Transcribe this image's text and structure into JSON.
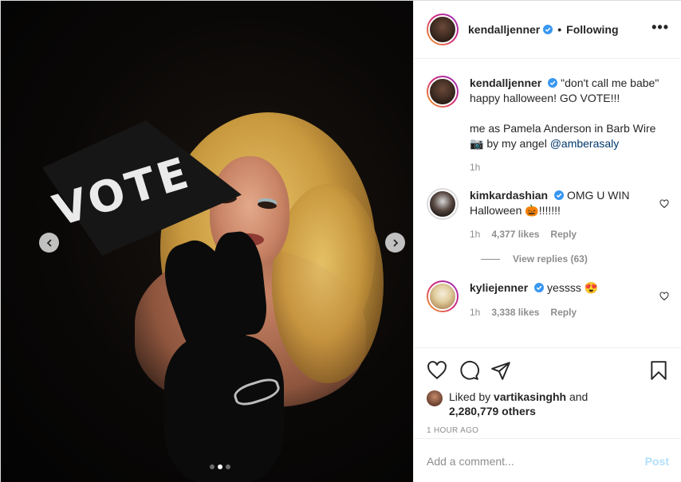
{
  "post": {
    "flag_text": "VOTE",
    "carousel": {
      "slides": 3,
      "active": 1
    }
  },
  "header": {
    "username": "kendalljenner",
    "separator": "•",
    "follow_status": "Following",
    "more": "•••"
  },
  "caption": {
    "username": "kendalljenner",
    "line1": "\"don't call me babe\" happy halloween! GO VOTE!!!",
    "line2_prefix": "me as Pamela Anderson in Barb Wire",
    "camera_emoji": "📷",
    "line2_mid": "by my angel",
    "mention": "@amberasaly",
    "time": "1h"
  },
  "comments": [
    {
      "username": "kimkardashian",
      "text_before": "OMG U WIN Halloween",
      "emoji": "🎃",
      "text_after": "!!!!!!!",
      "time": "1h",
      "likes": "4,377 likes",
      "reply": "Reply",
      "view_replies": "View replies (63)"
    },
    {
      "username": "kyliejenner",
      "text_before": "yessss",
      "emoji": "😍",
      "text_after": "",
      "time": "1h",
      "likes": "3,338 likes",
      "reply": "Reply"
    }
  ],
  "likes": {
    "prefix": "Liked by",
    "user": "vartikasinghh",
    "and": "and",
    "others": "2,280,779 others"
  },
  "timestamp": "1 HOUR AGO",
  "add_comment": {
    "placeholder": "Add a comment...",
    "post_label": "Post"
  },
  "colors": {
    "verified": "#3897f0",
    "link": "#00376b",
    "post_disabled": "#b2dffc"
  },
  "icons": [
    "chevron-left-icon",
    "chevron-right-icon",
    "verified-icon",
    "heart-icon",
    "comment-icon",
    "share-icon",
    "bookmark-icon"
  ]
}
